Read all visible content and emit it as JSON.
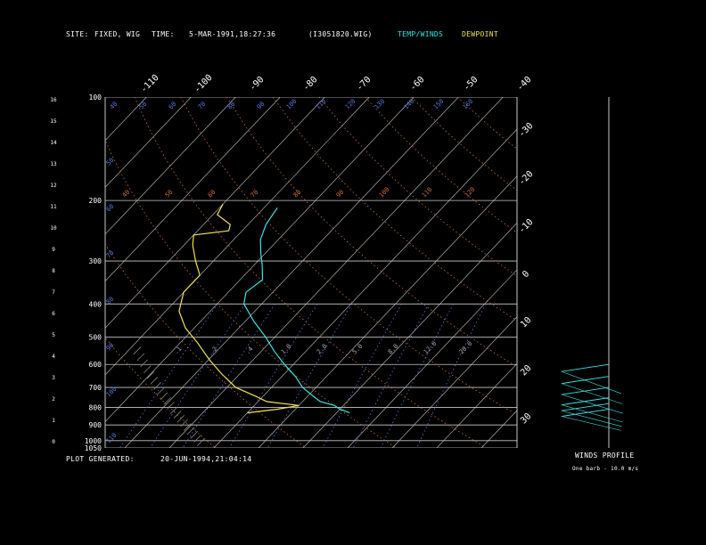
{
  "header": {
    "site_label": "SITE:",
    "site_value": "FIXED, WIG",
    "time_label": "TIME:",
    "time_value": "5-MAR-1991,18:27:36",
    "file_value": "(I3051820.WIG)",
    "legend_temp": "TEMP/WINDS",
    "legend_dew": "DEWPOINT"
  },
  "footer": {
    "plot_label": "PLOT GENERATED:",
    "plot_value": "20-JUN-1994,21:04:14",
    "wind_title": "WINDS PROFILE",
    "wind_note": "One barb - 10.0 m/s"
  },
  "colors": {
    "background": "#000000",
    "grid": "#c8c8c8",
    "temp": "#33e6e6",
    "dewpoint": "#f2e34a",
    "mixing": "#5a78e0",
    "theta": "#d07030"
  },
  "chart_data": {
    "type": "line",
    "title": "",
    "pressure_axis": {
      "labels": [
        "100",
        "200",
        "300",
        "400",
        "500",
        "600",
        "700",
        "800",
        "900",
        "1000",
        "1050"
      ],
      "values": [
        100,
        200,
        300,
        400,
        500,
        600,
        700,
        800,
        900,
        1000,
        1050
      ]
    },
    "height_axis": {
      "labels": [
        "16",
        "15",
        "14",
        "13",
        "12",
        "11",
        "10",
        "9",
        "8",
        "7",
        "6",
        "5",
        "4",
        "3",
        "2",
        "1",
        "0"
      ]
    },
    "temperature_ticks_top": [
      "-110",
      "-100",
      "-90",
      "-80",
      "-70",
      "-60",
      "-50",
      "-40"
    ],
    "temperature_ticks_right": [
      "-30",
      "-20",
      "-10",
      "0",
      "10",
      "20",
      "30"
    ],
    "mixing_ratio_labels": [
      ".1",
      ".2",
      ".4",
      "1.0",
      "2.0",
      "5.0",
      "8.0",
      "12.0",
      "20.0"
    ],
    "theta_labels": [
      "40",
      "50",
      "60",
      "70",
      "80",
      "90",
      "100",
      "110",
      "120",
      "130",
      "140",
      "150",
      "160"
    ],
    "theta_labels_mid": [
      "50",
      "60",
      "70",
      "80",
      "90",
      "100",
      "110"
    ],
    "series": [
      {
        "name": "TEMP/WINDS",
        "color": "#33e6e6",
        "points": [
          {
            "p": 210,
            "t": -57
          },
          {
            "p": 235,
            "t": -56
          },
          {
            "p": 260,
            "t": -54
          },
          {
            "p": 285,
            "t": -51
          },
          {
            "p": 310,
            "t": -48
          },
          {
            "p": 340,
            "t": -45
          },
          {
            "p": 370,
            "t": -46
          },
          {
            "p": 400,
            "t": -44
          },
          {
            "p": 450,
            "t": -38
          },
          {
            "p": 500,
            "t": -32
          },
          {
            "p": 550,
            "t": -27
          },
          {
            "p": 600,
            "t": -22
          },
          {
            "p": 650,
            "t": -17
          },
          {
            "p": 700,
            "t": -13
          },
          {
            "p": 740,
            "t": -9
          },
          {
            "p": 770,
            "t": -6
          },
          {
            "p": 790,
            "t": -2
          },
          {
            "p": 810,
            "t": 0
          },
          {
            "p": 830,
            "t": 3
          }
        ]
      },
      {
        "name": "DEWPOINT",
        "color": "#f2e34a",
        "points": [
          {
            "p": 205,
            "t": -70
          },
          {
            "p": 220,
            "t": -69
          },
          {
            "p": 235,
            "t": -64
          },
          {
            "p": 245,
            "t": -63
          },
          {
            "p": 252,
            "t": -70
          },
          {
            "p": 270,
            "t": -68
          },
          {
            "p": 300,
            "t": -64
          },
          {
            "p": 330,
            "t": -60
          },
          {
            "p": 370,
            "t": -60
          },
          {
            "p": 420,
            "t": -57
          },
          {
            "p": 470,
            "t": -52
          },
          {
            "p": 520,
            "t": -46
          },
          {
            "p": 580,
            "t": -40
          },
          {
            "p": 640,
            "t": -34
          },
          {
            "p": 700,
            "t": -28
          },
          {
            "p": 740,
            "t": -22
          },
          {
            "p": 770,
            "t": -18
          },
          {
            "p": 790,
            "t": -10
          },
          {
            "p": 810,
            "t": -14
          },
          {
            "p": 830,
            "t": -20
          }
        ]
      }
    ],
    "winds": [
      {
        "p": 600,
        "speed": 45,
        "dir": 250
      },
      {
        "p": 650,
        "speed": 40,
        "dir": 245
      },
      {
        "p": 700,
        "speed": 35,
        "dir": 240
      },
      {
        "p": 750,
        "speed": 30,
        "dir": 235
      },
      {
        "p": 780,
        "speed": 25,
        "dir": 230
      },
      {
        "p": 810,
        "speed": 20,
        "dir": 220
      }
    ]
  }
}
